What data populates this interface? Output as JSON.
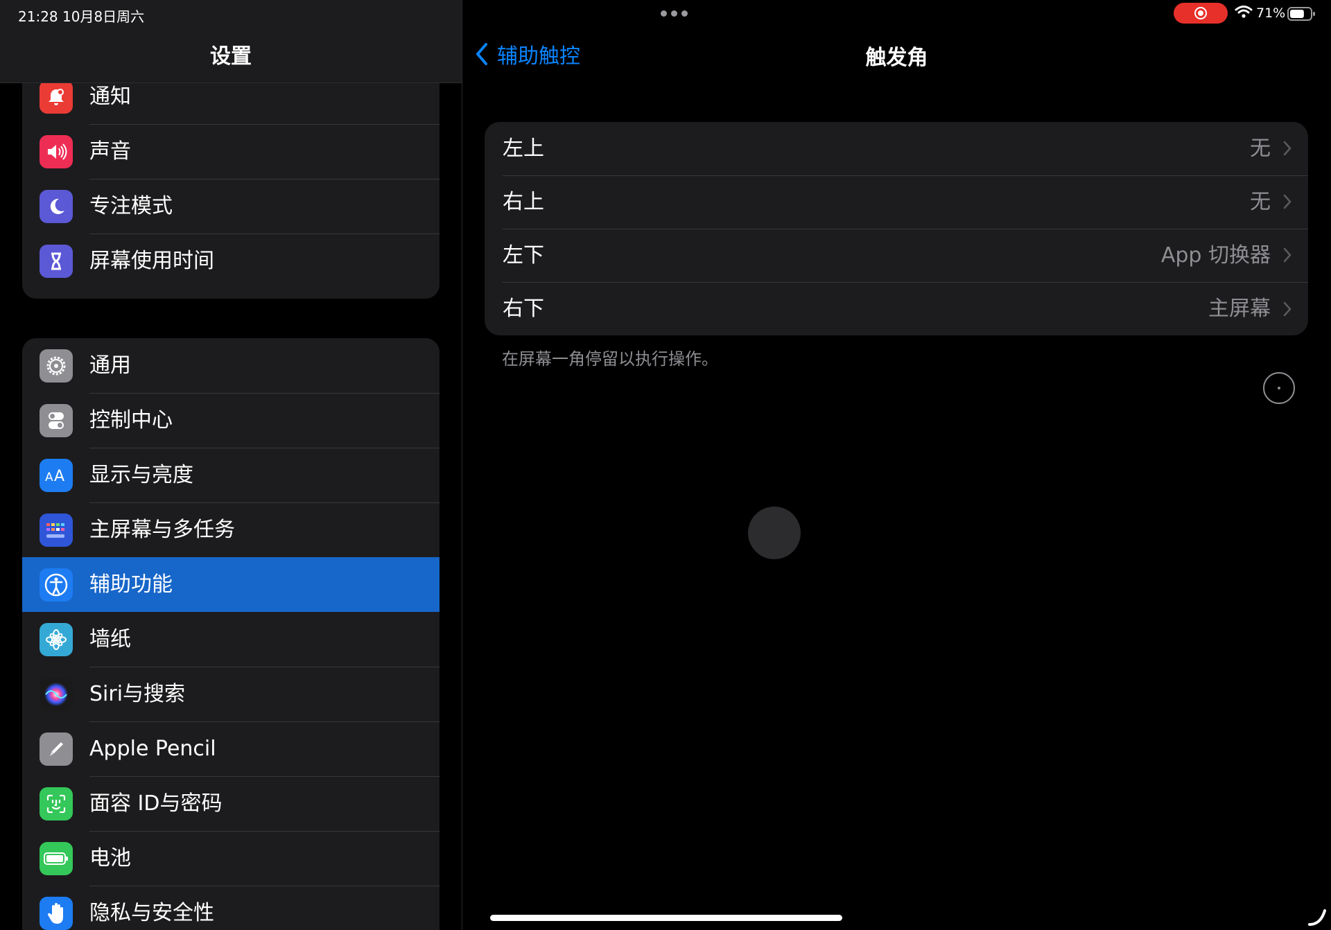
{
  "status_bar": {
    "time_date": "21:28   10月8日周六",
    "battery_percent": "71%",
    "battery_level": 0.71,
    "recording": true
  },
  "sidebar": {
    "title": "设置",
    "group1": [
      {
        "label": "通知",
        "icon": "notification-bell-icon",
        "color": "#eb3b35"
      },
      {
        "label": "声音",
        "icon": "speaker-icon",
        "color": "#ee2d55"
      },
      {
        "label": "专注模式",
        "icon": "moon-icon",
        "color": "#5c59d6"
      },
      {
        "label": "屏幕使用时间",
        "icon": "hourglass-icon",
        "color": "#5c59d6"
      }
    ],
    "group2": [
      {
        "label": "通用",
        "icon": "gear-icon",
        "color": "#8e8e93"
      },
      {
        "label": "控制中心",
        "icon": "toggles-icon",
        "color": "#8e8e93"
      },
      {
        "label": "显示与亮度",
        "icon": "text-size-icon",
        "color": "#1d7cf2"
      },
      {
        "label": "主屏幕与多任务",
        "icon": "home-grid-icon",
        "color": "#2f56d8"
      },
      {
        "label": "辅助功能",
        "icon": "accessibility-icon",
        "color": "#1d7cf2",
        "selected": true
      },
      {
        "label": "墙纸",
        "icon": "flower-icon",
        "color": "#35a9d6"
      },
      {
        "label": "Siri与搜索",
        "icon": "siri-icon",
        "color": "#1a1a1a"
      },
      {
        "label": "Apple Pencil",
        "icon": "pencil-icon",
        "color": "#8e8e93"
      },
      {
        "label": "面容 ID与密码",
        "icon": "face-id-icon",
        "color": "#34c759"
      },
      {
        "label": "电池",
        "icon": "battery-icon",
        "color": "#34c759"
      },
      {
        "label": "隐私与安全性",
        "icon": "hand-icon",
        "color": "#1d7cf2"
      }
    ]
  },
  "detail": {
    "back_label": "辅助触控",
    "title": "触发角",
    "corners": [
      {
        "label": "左上",
        "value": "无"
      },
      {
        "label": "右上",
        "value": "无"
      },
      {
        "label": "左下",
        "value": "App 切换器"
      },
      {
        "label": "右下",
        "value": "主屏幕"
      }
    ],
    "footnote": "在屏幕一角停留以执行操作。"
  }
}
